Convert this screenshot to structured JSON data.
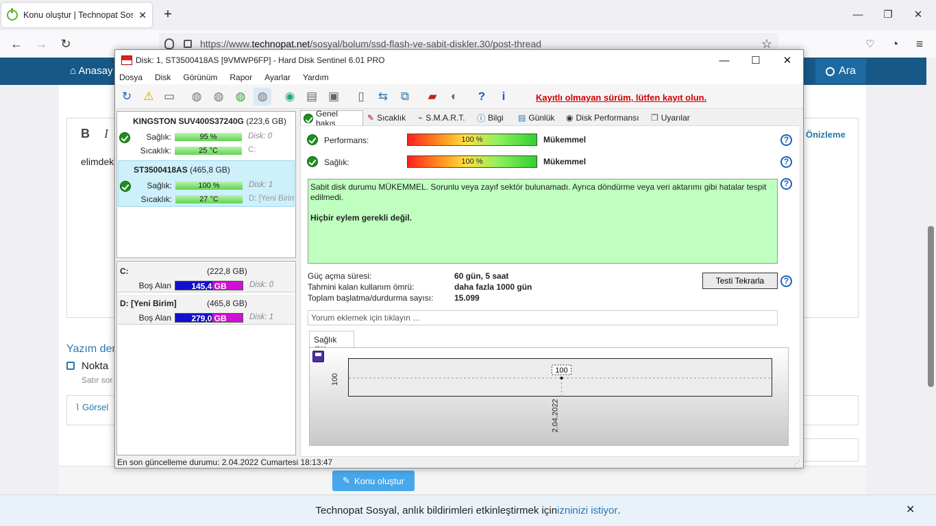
{
  "browser": {
    "tab_title": "Konu oluştur | Technopat Sosyal",
    "new_tab": "+",
    "url_prefix": "https://www.",
    "url_domain": "technopat.net",
    "url_path": "/sosyal/bolum/ssd-flash-ve-sabit-diskler.30/post-thread"
  },
  "site": {
    "home_label": "Anasay",
    "search_label": "Ara",
    "preview_label": "Önizleme",
    "editor_bold": "B",
    "editor_italic": "I",
    "editor_text": "elimdek",
    "section_title": "Yazım der",
    "checkbox_label": "Nokta",
    "checkbox_sub": "Satır sor",
    "attach_label": "Görsel",
    "submit_label": "Konu oluştur"
  },
  "notification": {
    "text": "Technopat Sosyal, anlık bildirimleri etkinleştirmek için ",
    "link": "izninizi istiyor",
    "end": "."
  },
  "hds": {
    "title": "Disk: 1, ST3500418AS [9VMWP6FP]  -  Hard Disk Sentinel 6.01 PRO",
    "menu": [
      "Dosya",
      "Disk",
      "Görünüm",
      "Rapor",
      "Ayarlar",
      "Yardım"
    ],
    "warning": "Kayıtlı olmayan sürüm, lütfen kayıt olun.",
    "disks": [
      {
        "name": "KINGSTON SUV400S37240G",
        "size": "(223,6 GB)",
        "health_label": "Sağlık:",
        "health": "95 %",
        "temp_label": "Sıcaklık:",
        "temp": "25 °C",
        "disk_no": "Disk: 0",
        "drive": "C:"
      },
      {
        "name": "ST3500418AS",
        "size": "(465,8 GB)",
        "health_label": "Sağlık:",
        "health": "100 %",
        "temp_label": "Sıcaklık:",
        "temp": "27 °C",
        "disk_no": "Disk: 1",
        "drive": "D: [Yeni Birim"
      }
    ],
    "volumes": [
      {
        "name": "C:",
        "size": "(222,8 GB)",
        "free_label": "Boş Alan",
        "free": "145,4 GB",
        "disk_no": "Disk: 0"
      },
      {
        "name": "D: [Yeni Birim]",
        "size": "(465,8 GB)",
        "free_label": "Boş Alan",
        "free": "279,0 GB",
        "disk_no": "Disk: 1"
      }
    ],
    "tabs": [
      "Genel bakış",
      "Sıcaklık",
      "S.M.A.R.T.",
      "Bilgi",
      "Günlük",
      "Disk Performansı",
      "Uyarılar"
    ],
    "performance_label": "Performans:",
    "performance_value": "100 %",
    "performance_text": "Mükemmel",
    "health_label": "Sağlık:",
    "health_value": "100 %",
    "health_text": "Mükemmel",
    "description": "Sabit disk durumu MÜKEMMEL. Sorunlu veya zayıf sektör bulunamadı. Ayrıca döndürme veya veri aktarımı gibi hatalar tespit edilmedi.",
    "action": "Hiçbir eylem gerekli değil.",
    "stats": [
      {
        "label": "Güç açma süresi:",
        "value": "60 gün, 5 saat"
      },
      {
        "label": "Tahmini kalan kullanım ömrü:",
        "value": "daha fazla 1000 gün"
      },
      {
        "label": "Toplam başlatma/durdurma sayısı:",
        "value": "15.099"
      }
    ],
    "test_button": "Testi Tekrarla",
    "comment_placeholder": "Yorum eklemek için tıklayın ...",
    "chart_tab": "Sağlık (%)",
    "status": "En son güncelleme durumu: 2.04.2022 Cumartesi 18:13:47"
  },
  "chart_data": {
    "type": "line",
    "x": [
      "2.04.2022"
    ],
    "series": [
      {
        "values": [
          100
        ]
      }
    ],
    "data_labels": [
      "100"
    ],
    "ytick_labels": [
      "100"
    ]
  }
}
